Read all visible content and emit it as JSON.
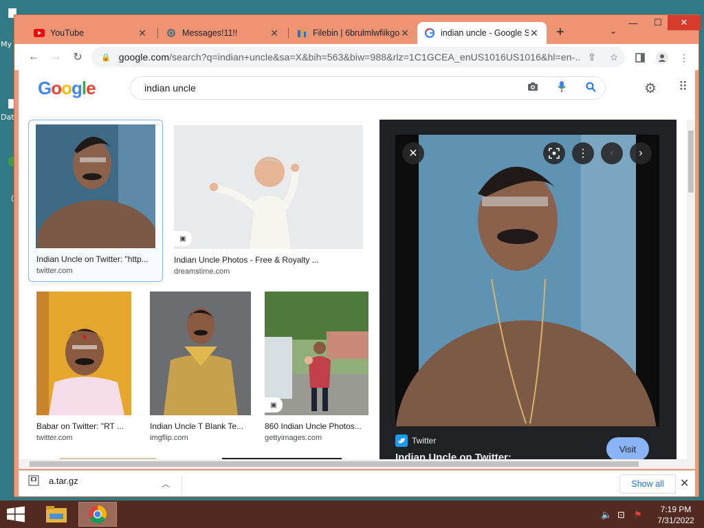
{
  "desktop": {
    "labels": [
      "My",
      "Dat",
      "("
    ]
  },
  "browser": {
    "tabs": [
      {
        "title": "YouTube",
        "icon": "youtube-icon"
      },
      {
        "title": "Messages!11!!",
        "icon": "globe-icon"
      },
      {
        "title": "Filebin | 6brulmlwfiikgo",
        "icon": "filebin-icon"
      },
      {
        "title": "indian uncle - Google S",
        "icon": "google-icon",
        "active": true
      }
    ],
    "url_host": "google.com",
    "url_rest": "/search?q=indian+uncle&sa=X&bih=563&biw=988&rlz=1C1GCEA_enUS1016US1016&hl=en-..."
  },
  "search": {
    "logo": "Google",
    "query": "indian uncle"
  },
  "results": [
    {
      "caption": "Indian Uncle on Twitter: \"http...",
      "source": "twitter.com"
    },
    {
      "caption": "Indian Uncle Photos - Free & Royalty ...",
      "source": "dreamstime.com"
    },
    {
      "caption": "Babar on Twitter: \"RT ...",
      "source": "twitter.com"
    },
    {
      "caption": "Indian Uncle T Blank Te...",
      "source": "imgflip.com"
    },
    {
      "caption": "860 Indian Uncle Photos...",
      "source": "gettyimages.com"
    }
  ],
  "preview": {
    "source": "Twitter",
    "title": "Indian Uncle on Twitter:",
    "visit_label": "Visit"
  },
  "downloads": {
    "file": "a.tar.gz",
    "show_all": "Show all"
  },
  "taskbar": {
    "time": "7:19 PM",
    "date": "7/31/2022"
  },
  "colors": {
    "desktop": "#2f7a85",
    "window_frame": "#f0997a",
    "taskbar": "#522a1f",
    "accent_blue": "#1a73e8",
    "visit_button": "#8ab4f8"
  }
}
